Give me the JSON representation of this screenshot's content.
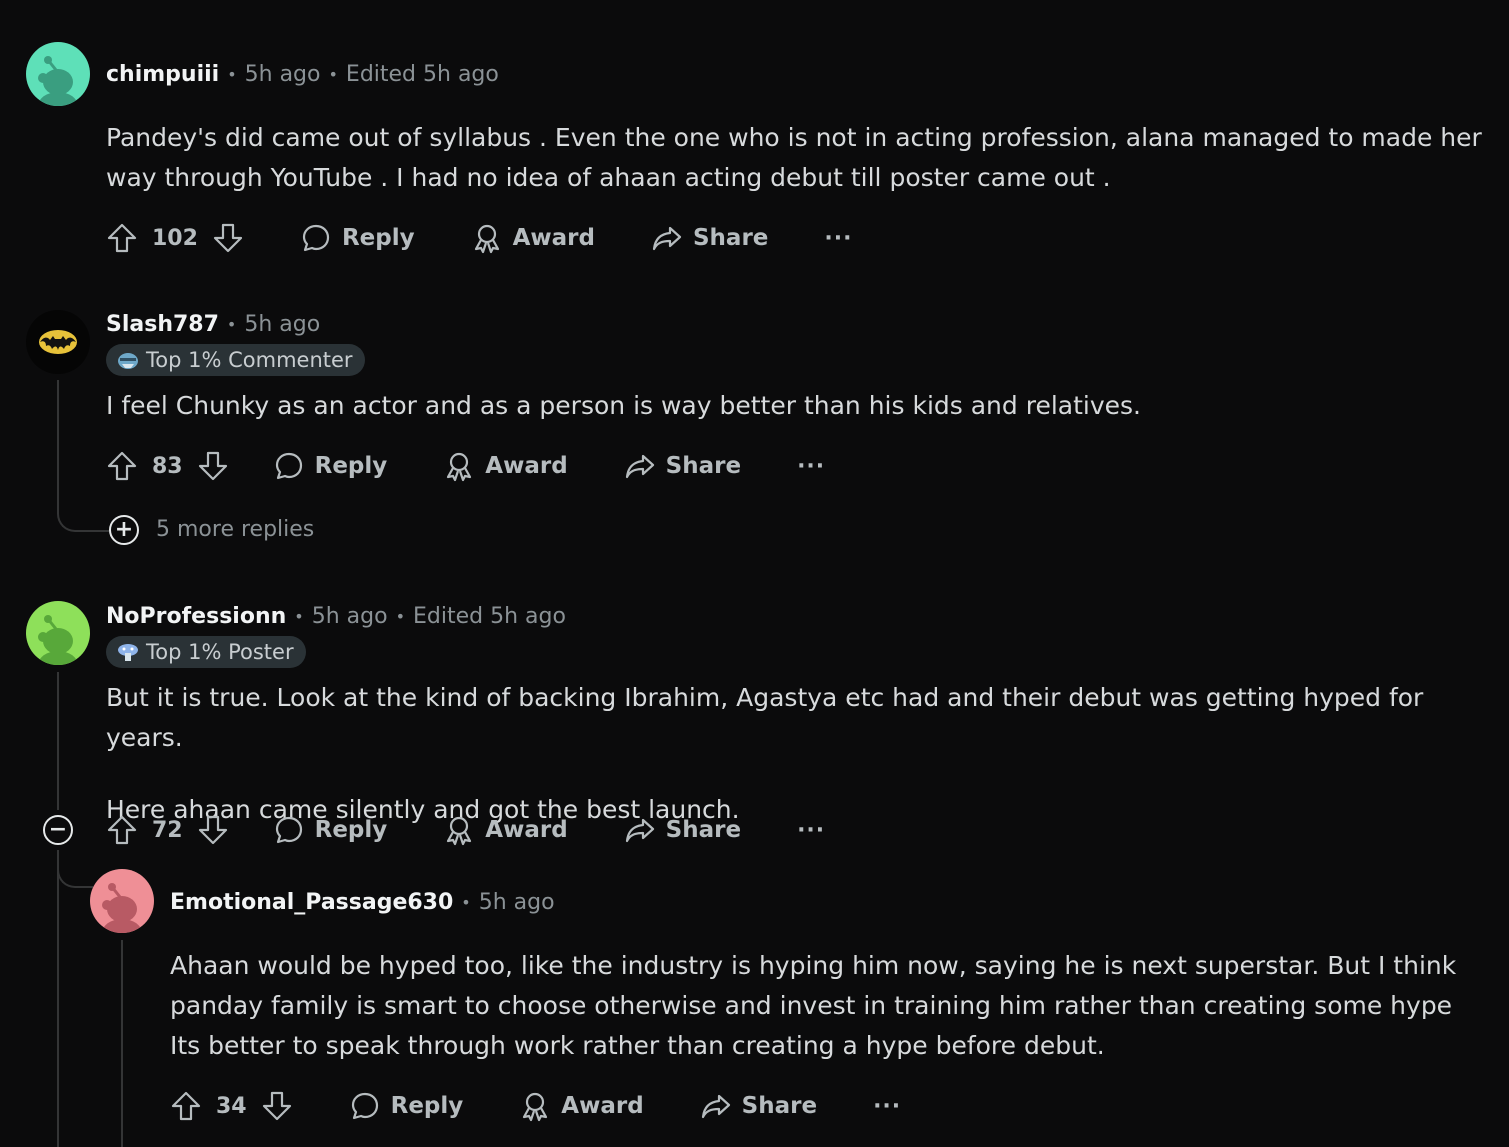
{
  "actions": {
    "reply": "Reply",
    "award": "Award",
    "share": "Share",
    "more": "···"
  },
  "comments": [
    {
      "author": "chimpuiii",
      "time": "5h ago",
      "edited": "Edited 5h ago",
      "avatar_color": "#5ee0b8",
      "body": [
        "Pandey's did came out of syllabus . Even the one who is not in acting profession, alana managed to made her way through YouTube . I had no idea of ahaan acting debut till poster came out ."
      ],
      "votes": "102"
    },
    {
      "author": "Slash787",
      "time": "5h ago",
      "flair": "Top 1% Commenter",
      "avatar_color": "#000000",
      "body": [
        "I feel Chunky as an actor and as a person is way better than his kids and relatives."
      ],
      "votes": "83",
      "more_replies": "5 more replies"
    },
    {
      "author": "NoProfessionn",
      "time": "5h ago",
      "edited": "Edited 5h ago",
      "flair": "Top 1% Poster",
      "avatar_color": "#8ee05a",
      "body": [
        "But it is true. Look at the kind of backing Ibrahim, Agastya etc had and their debut was getting hyped for years.",
        "Here ahaan came silently and got the best launch."
      ],
      "votes": "72"
    },
    {
      "author": "Emotional_Passage630",
      "time": "5h ago",
      "avatar_color": "#ef8f96",
      "body": [
        "Ahaan would be hyped too, like the industry is hyping him now, saying he is next superstar. But I think panday family is smart to choose otherwise and invest in training him rather than creating some hype Its better to speak through work rather than creating a hype before debut."
      ],
      "votes": "34"
    }
  ]
}
